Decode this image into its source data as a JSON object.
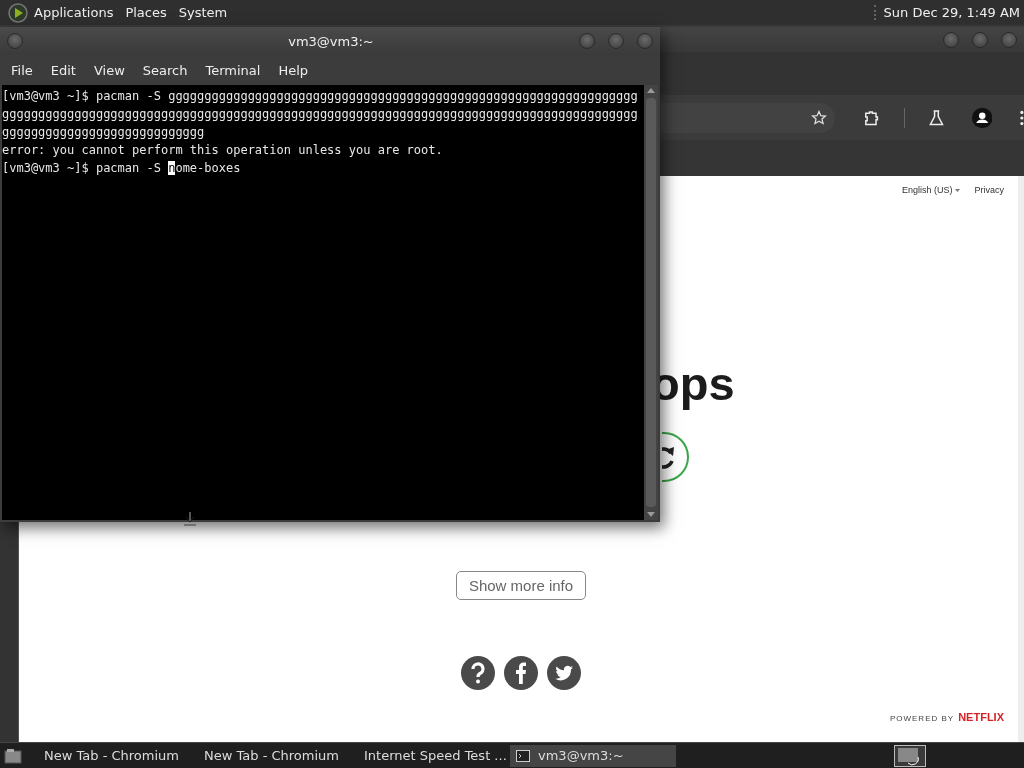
{
  "top_panel": {
    "menus": [
      "Applications",
      "Places",
      "System"
    ],
    "clock": "Sun Dec 29, 1:49 AM"
  },
  "browser": {
    "page": {
      "language": "English (US)",
      "privacy": "Privacy",
      "heading": "ops",
      "button": "Show more info",
      "powered_by": "POWERED BY",
      "brand": "NETFLIX"
    }
  },
  "terminal": {
    "title": "vm3@vm3:~",
    "menu": [
      "File",
      "Edit",
      "View",
      "Search",
      "Terminal",
      "Help"
    ],
    "lines": [
      {
        "kind": "text",
        "text": "[vm3@vm3 ~]$ pacman -S ggggggggggggggggggggggggggggggggggggggggggggggggggggggggggggggggggggggggggggggggggggggggggggggggggggggggggggggggggggggggggggggggggggggggggggggggggggggggggggggggggggggggggggggggggggg"
      },
      {
        "kind": "text",
        "text": "error: you cannot perform this operation unless you are root."
      },
      {
        "kind": "cursor",
        "before": "[vm3@vm3 ~]$ pacman -S ",
        "cursor": "n",
        "after": "ome-boxes"
      }
    ]
  },
  "taskbar": {
    "items": [
      {
        "label": "New Tab - Chromium",
        "kind": "browser",
        "selected": false
      },
      {
        "label": "New Tab - Chromium",
        "kind": "browser",
        "selected": false
      },
      {
        "label": "Internet Speed Test ...",
        "kind": "browser",
        "selected": false
      },
      {
        "label": "vm3@vm3:~",
        "kind": "terminal",
        "selected": true
      }
    ]
  }
}
